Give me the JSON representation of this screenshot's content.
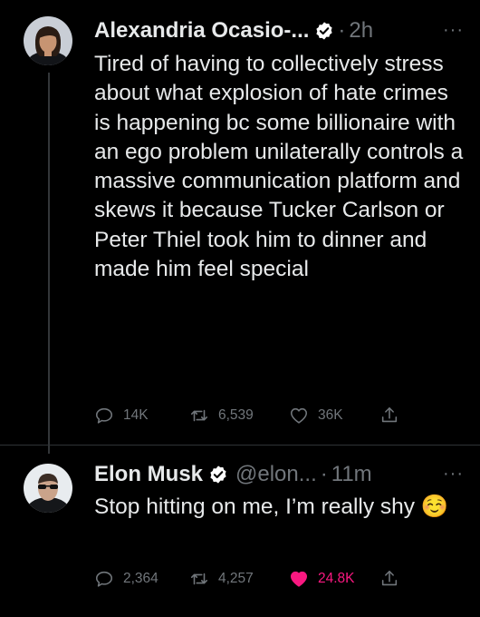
{
  "tweets": [
    {
      "name": "Alexandria Ocasio-...",
      "handle": "",
      "time": "2h",
      "text": "Tired of having to collectively stress about what explosion of hate crimes is happening bc some billionaire with an ego problem unilaterally controls a massive communication platform and skews it because Tucker Carlson or Peter Thiel took him to dinner and made him feel special",
      "replies": "14K",
      "retweets": "6,539",
      "likes": "36K",
      "liked": false
    },
    {
      "name": "Elon Musk",
      "handle": "@elon...",
      "time": "11m",
      "text": "Stop hitting on me, I’m really shy ☺️",
      "replies": "2,364",
      "retweets": "4,257",
      "likes": "24.8K",
      "liked": true
    }
  ],
  "colors": {
    "like_active": "#f91880",
    "verified": "#ffffff",
    "muted": "#71767b"
  },
  "icons": [
    "reply-icon",
    "retweet-icon",
    "like-icon",
    "share-icon",
    "verified-icon",
    "more-icon"
  ],
  "separator": "·",
  "more_label": "···"
}
